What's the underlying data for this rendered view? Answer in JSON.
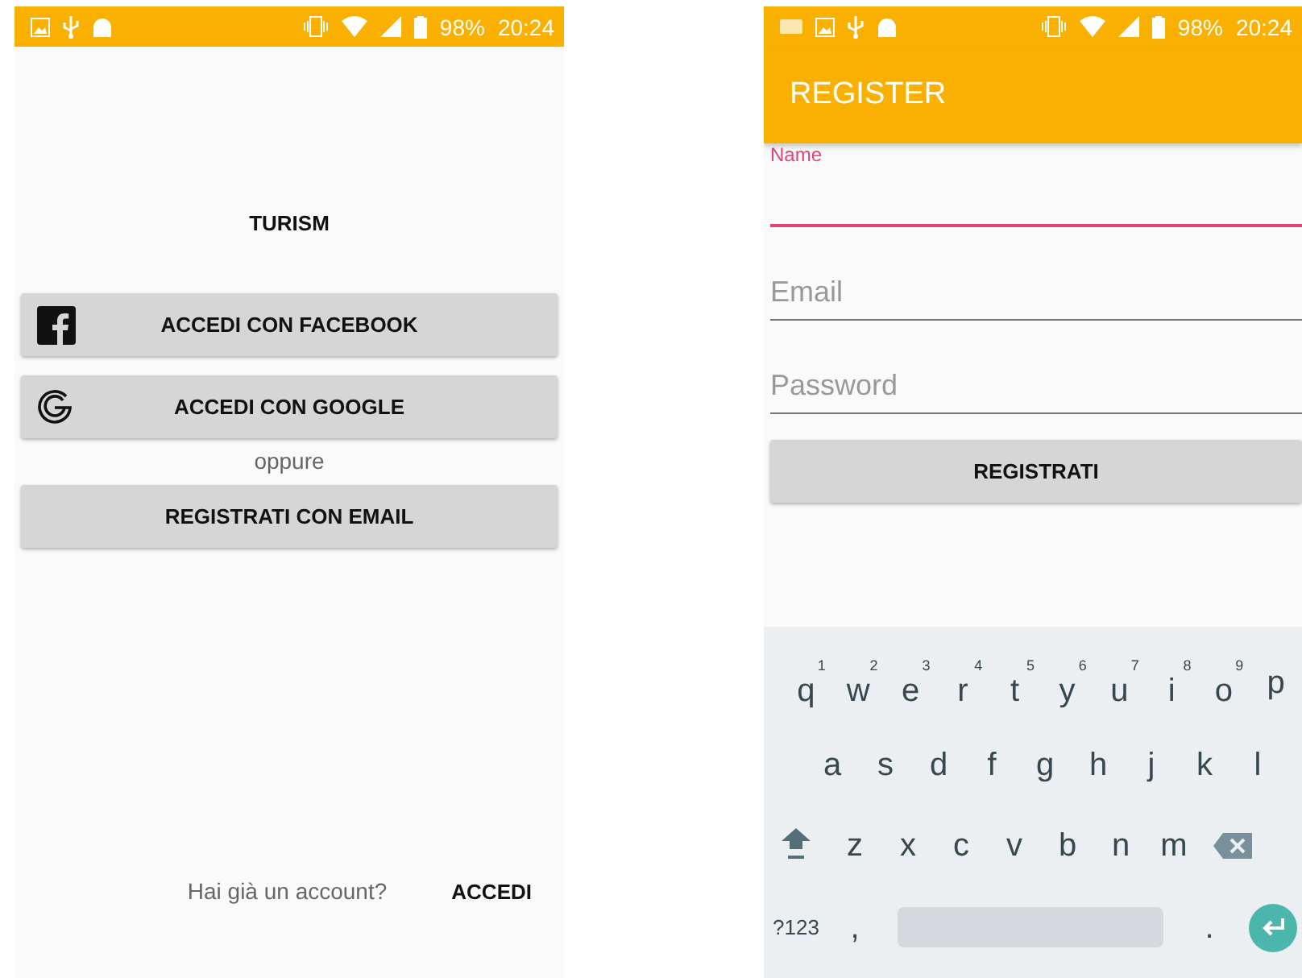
{
  "login_screen": {
    "status_bar": {
      "battery": "98%",
      "time": "20:24"
    },
    "title": "TURISM",
    "buttons": [
      {
        "kind": "facebook",
        "label": "ACCEDI CON FACEBOOK"
      },
      {
        "kind": "google",
        "label": "ACCEDI CON GOOGLE"
      },
      {
        "kind": "separator",
        "label": "oppure"
      },
      {
        "kind": "plain",
        "label": "REGISTRATI CON EMAIL"
      }
    ],
    "footer": {
      "question": "Hai già un account?",
      "link": "ACCEDI"
    }
  },
  "register_screen": {
    "status_bar": {
      "battery": "98%",
      "time": "20:24"
    },
    "app_bar": {
      "title": "REGISTER"
    },
    "fields": [
      {
        "placeholder": "Name",
        "focused": true
      },
      {
        "placeholder": "Email",
        "focused": false
      },
      {
        "placeholder": "Password",
        "focused": false
      }
    ],
    "submit": "REGISTRATI",
    "keyboard": {
      "rows": [
        [
          {
            "key": "q",
            "hint": "1"
          },
          {
            "key": "w",
            "hint": "2"
          },
          {
            "key": "e",
            "hint": "3"
          },
          {
            "key": "r",
            "hint": "4"
          },
          {
            "key": "t",
            "hint": "5"
          },
          {
            "key": "y",
            "hint": "6"
          },
          {
            "key": "u",
            "hint": "7"
          },
          {
            "key": "i",
            "hint": "8"
          },
          {
            "key": "o",
            "hint": "9"
          },
          {
            "key": "p"
          }
        ],
        [
          {
            "key": "a"
          },
          {
            "key": "s"
          },
          {
            "key": "d"
          },
          {
            "key": "f"
          },
          {
            "key": "g"
          },
          {
            "key": "h"
          },
          {
            "key": "j"
          },
          {
            "key": "k"
          },
          {
            "key": "l"
          }
        ],
        [
          {
            "key": "z"
          },
          {
            "key": "x"
          },
          {
            "key": "c"
          },
          {
            "key": "v"
          },
          {
            "key": "b"
          },
          {
            "key": "n"
          },
          {
            "key": "m"
          }
        ]
      ],
      "symbols_key": "?123",
      "comma_key": ",",
      "period_key": "."
    }
  }
}
